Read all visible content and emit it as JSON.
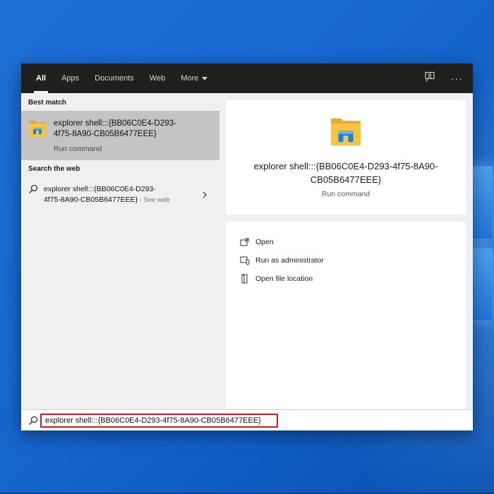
{
  "topbar": {
    "tabs": [
      {
        "label": "All",
        "active": true
      },
      {
        "label": "Apps",
        "active": false
      },
      {
        "label": "Documents",
        "active": false
      },
      {
        "label": "Web",
        "active": false
      },
      {
        "label": "More",
        "active": false
      }
    ],
    "feedback_icon": "feedback-icon",
    "options_icon": "ellipsis-icon",
    "options_label": "···"
  },
  "best_match": {
    "heading": "Best match",
    "title_line1": "explorer shell:::{BB06C0E4-D293-",
    "title_line2": "4f75-8A90-CB05B6477EEE}",
    "subtitle": "Run command",
    "icon": "file-explorer-icon"
  },
  "web_search": {
    "heading": "Search the web",
    "title_line1": "explorer shell:::{BB06C0E4-D293-",
    "title_line2": "4f75-8A90-CB05B6477EEE}",
    "see_web": " - See web",
    "icon": "search-icon"
  },
  "preview": {
    "title_line1": "explorer shell:::{BB06C0E4-D293-4f75-8A90-",
    "title_line2": "CB05B6477EEE}",
    "subtitle": "Run command",
    "icon": "file-explorer-icon"
  },
  "actions": [
    {
      "label": "Open",
      "icon": "open-icon"
    },
    {
      "label": "Run as administrator",
      "icon": "shield-icon"
    },
    {
      "label": "Open file location",
      "icon": "file-location-icon"
    }
  ],
  "search": {
    "value": "explorer shell:::{BB06C0E4-D293-4f75-8A90-CB05B6477EEE}",
    "highlight_color": "#e3131a"
  },
  "colors": {
    "topbar": "#1f1f1f",
    "selected_item": "#c4c4c4",
    "panel": "#f0f0f0",
    "desktop": "#1768d0",
    "folder_yellow": "#f6c343",
    "explorer_blue": "#1f7fd6"
  }
}
